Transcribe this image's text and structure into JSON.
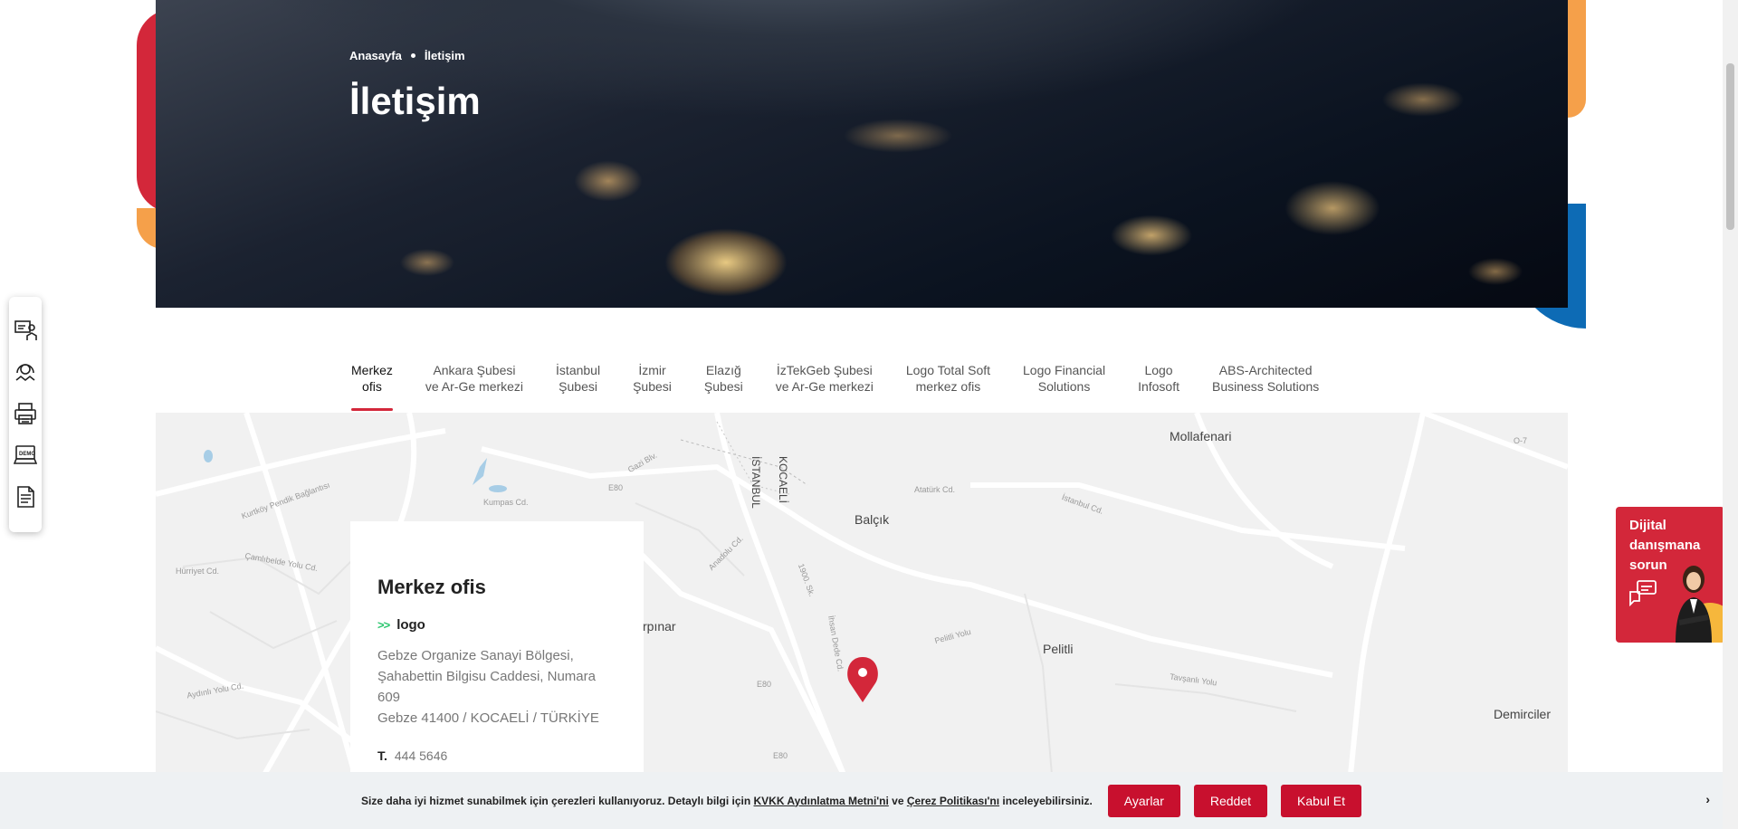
{
  "breadcrumb": {
    "home": "Anasayfa",
    "current": "İletişim"
  },
  "page_title": "İletişim",
  "tabs": [
    {
      "label": "Merkez\nofis",
      "active": true
    },
    {
      "label": "Ankara Şubesi\nve Ar-Ge merkezi"
    },
    {
      "label": "İstanbul\nŞubesi"
    },
    {
      "label": "İzmir\nŞubesi"
    },
    {
      "label": "Elazığ\nŞubesi"
    },
    {
      "label": "İzTekGeb Şubesi\nve Ar-Ge merkezi"
    },
    {
      "label": "Logo Total Soft\nmerkez ofis"
    },
    {
      "label": "Logo Financial\nSolutions"
    },
    {
      "label": "Logo\nInfosoft"
    },
    {
      "label": "ABS-Architected\nBusiness Solutions"
    }
  ],
  "map": {
    "places": {
      "mollafenari": "Mollafenari",
      "balcik": "Balçık",
      "pelitli": "Pelitli",
      "demirciler": "Demirciler",
      "arpinar": "rpınar",
      "istanbul": "İSTANBUL",
      "kocaeli": "KOCAELİ"
    },
    "roads": {
      "kurtkoy": "Kurtköy Pendik Bağlantısı",
      "e80_1": "E80",
      "e80_2": "E80",
      "e80_3": "E80",
      "gazi": "Gazi Blv.",
      "kumpas": "Kumpas Cd.",
      "ataturk": "Atatürk Cd.",
      "istanbul_cd": "İstanbul Cd.",
      "anadolu": "Anadolu Cd.",
      "sok1900": "1900. Sk.",
      "ihsan": "İhsan Dede Cd.",
      "pelitli_yolu": "Pelitli Yolu",
      "tavsanli": "Tavşanlı Yolu",
      "hurriyet": "Hürriyet Cd.",
      "camlibelde": "Çamlıbelde Yolu Cd.",
      "aydinli": "Aydınlı Yolu Cd.",
      "o7": "O-7"
    }
  },
  "office": {
    "title": "Merkez ofis",
    "arrow": ">>",
    "brand": "logo",
    "address": "Gebze Organize Sanayi Bölgesi,\nŞahabettin Bilgisu Caddesi, Numara\n609\nGebze 41400 / KOCAELİ / TÜRKİYE",
    "phone_label": "T.",
    "phone": "444 5646"
  },
  "advisor": {
    "text": "Dijital danışmana sorun"
  },
  "cookie": {
    "text_before": "Size daha iyi hizmet sunabilmek için çerezleri kullanıyoruz. Detaylı bilgi için ",
    "kvkk_link": "KVKK Aydınlatma Metni'ni",
    "text_mid": " ve ",
    "policy_link": "Çerez Politikası'nı",
    "text_after": " inceleyebilirsiniz.",
    "settings": "Ayarlar",
    "reject": "Reddet",
    "accept": "Kabul Et"
  },
  "icons": [
    "training-icon",
    "support-icon",
    "print-icon",
    "demo-icon",
    "document-icon",
    "close-chevron-icon"
  ],
  "colors": {
    "brand_red": "#d3273a",
    "accent_green": "#2bc66e",
    "blue": "#0d6bb5",
    "orange": "#f5a04a"
  }
}
